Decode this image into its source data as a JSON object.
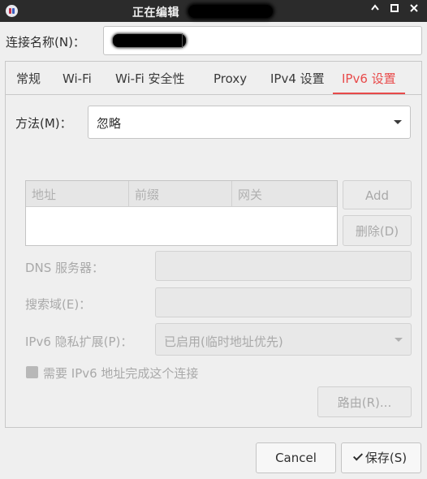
{
  "window": {
    "title": "正在编辑"
  },
  "connection": {
    "label": "连接名称(N)：",
    "value": ""
  },
  "tabs": [
    {
      "label": "常规",
      "active": false
    },
    {
      "label": "Wi-Fi",
      "active": false
    },
    {
      "label": "Wi-Fi 安全性",
      "active": false
    },
    {
      "label": "Proxy",
      "active": false
    },
    {
      "label": "IPv4 设置",
      "active": false
    },
    {
      "label": "IPv6 设置",
      "active": true
    }
  ],
  "method": {
    "label": "方法(M)：",
    "value": "忽略"
  },
  "addresses": {
    "columns": [
      "地址",
      "前缀",
      "网关"
    ],
    "rows": [],
    "add_label": "Add",
    "delete_label": "删除(D)"
  },
  "dns": {
    "label": "DNS 服务器：",
    "value": ""
  },
  "search_domains": {
    "label": "搜索域(E)：",
    "value": ""
  },
  "privacy": {
    "label": "IPv6 隐私扩展(P)：",
    "value": "已启用(临时地址优先)"
  },
  "require": {
    "label": "需要 IPv6 地址完成这个连接",
    "checked": true
  },
  "routes": {
    "label": "路由(R)..."
  },
  "footer": {
    "cancel_label": "Cancel",
    "save_label": "保存(S)"
  },
  "colors": {
    "accent": "#e84a4a",
    "titlebar": "#2b2b2b"
  }
}
